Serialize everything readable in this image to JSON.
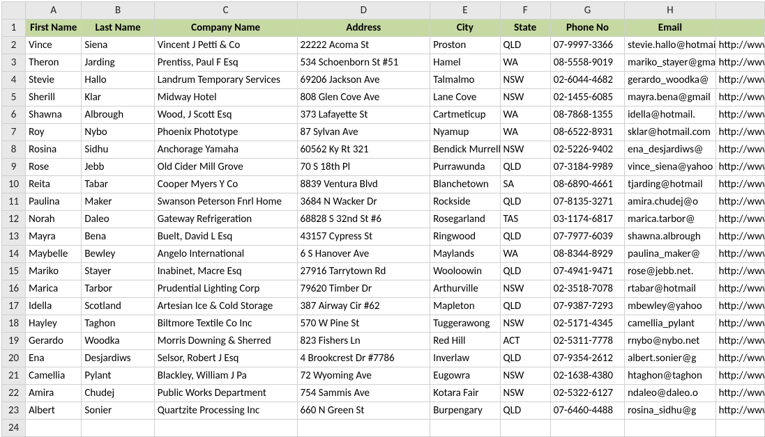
{
  "columns": [
    "A",
    "B",
    "C",
    "D",
    "E",
    "F",
    "G",
    "H",
    ""
  ],
  "headers": [
    "First Name",
    "Last Name",
    "Company Name",
    "Address",
    "City",
    "State",
    "Phone No",
    "Email",
    ""
  ],
  "rows": [
    {
      "n": 2,
      "c": [
        "Vince",
        "Siena",
        "Vincent J Petti & Co",
        "22222 Acoma St",
        "Proston",
        "QLD",
        "07-9997-3366",
        "stevie.hallo@hotmail.com",
        "http://www"
      ]
    },
    {
      "n": 3,
      "c": [
        "Theron",
        "Jarding",
        "Prentiss, Paul F Esq",
        "534 Schoenborn St #51",
        "Hamel",
        "WA",
        "08-5558-9019",
        "mariko_stayer@gmail.com",
        "http://www"
      ]
    },
    {
      "n": 4,
      "c": [
        "Stevie",
        "Hallo",
        "Landrum Temporary Services",
        "69206 Jackson Ave",
        "Talmalmo",
        "NSW",
        "02-6044-4682",
        "gerardo_woodka@",
        "http://www"
      ]
    },
    {
      "n": 5,
      "c": [
        "Sherill",
        "Klar",
        "Midway Hotel",
        "808 Glen Cove Ave",
        "Lane Cove",
        "NSW",
        "02-1455-6085",
        "mayra.bena@gmail",
        "http://www"
      ]
    },
    {
      "n": 6,
      "c": [
        "Shawna",
        "Albrough",
        "Wood, J Scott Esq",
        "373 Lafayette St",
        "Cartmeticup",
        "WA",
        "08-7868-1355",
        "idella@hotmail.",
        "http://www"
      ]
    },
    {
      "n": 7,
      "c": [
        "Roy",
        "Nybo",
        "Phoenix Phototype",
        "87 Sylvan Ave",
        "Nyamup",
        "WA",
        "08-6522-8931",
        "sklar@hotmail.com",
        "http://www"
      ]
    },
    {
      "n": 8,
      "c": [
        "Rosina",
        "Sidhu",
        "Anchorage Yamaha",
        "60562 Ky Rt 321",
        "Bendick Murrell",
        "NSW",
        "02-5226-9402",
        "ena_desjardiws@",
        "http://www"
      ]
    },
    {
      "n": 9,
      "c": [
        "Rose",
        "Jebb",
        "Old Cider Mill Grove",
        "70 S 18th Pl",
        "Purrawunda",
        "QLD",
        "07-3184-9989",
        "vince_siena@yahoo",
        "http://www"
      ]
    },
    {
      "n": 10,
      "c": [
        "Reita",
        "Tabar",
        "Cooper Myers Y Co",
        "8839 Ventura Blvd",
        "Blanchetown",
        "SA",
        "08-6890-4661",
        "tjarding@hotmail",
        "http://www"
      ]
    },
    {
      "n": 11,
      "c": [
        "Paulina",
        "Maker",
        "Swanson Peterson Fnrl Home",
        "3684 N Wacker Dr",
        "Rockside",
        "QLD",
        "07-8135-3271",
        "amira.chudej@o",
        "http://www"
      ]
    },
    {
      "n": 12,
      "c": [
        "Norah",
        "Daleo",
        "Gateway Refrigeration",
        "68828 S 32nd St #6",
        "Rosegarland",
        "TAS",
        "03-1174-6817",
        "marica.tarbor@",
        "http://www"
      ]
    },
    {
      "n": 13,
      "c": [
        "Mayra",
        "Bena",
        "Buelt, David L Esq",
        "43157 Cypress St",
        "Ringwood",
        "QLD",
        "07-7977-6039",
        "shawna.albrough",
        "http://www"
      ]
    },
    {
      "n": 14,
      "c": [
        "Maybelle",
        "Bewley",
        "Angelo International",
        "6 S Hanover Ave",
        "Maylands",
        "WA",
        "08-8344-8929",
        "paulina_maker@",
        "http://www"
      ]
    },
    {
      "n": 15,
      "c": [
        "Mariko",
        "Stayer",
        "Inabinet, Macre Esq",
        "27916 Tarrytown Rd",
        "Wooloowin",
        "QLD",
        "07-4941-9471",
        "rose@jebb.net.",
        "http://www"
      ]
    },
    {
      "n": 16,
      "c": [
        "Marica",
        "Tarbor",
        "Prudential Lighting Corp",
        "79620 Timber Dr",
        "Arthurville",
        "NSW",
        "02-3518-7078",
        "rtabar@hotmail",
        "http://www"
      ]
    },
    {
      "n": 17,
      "c": [
        "Idella",
        "Scotland",
        "Artesian Ice & Cold Storage",
        "387 Airway Cir #62",
        "Mapleton",
        "QLD",
        "07-9387-7293",
        "mbewley@yahoo",
        "http://www"
      ]
    },
    {
      "n": 18,
      "c": [
        "Hayley",
        "Taghon",
        "Biltmore Textile Co Inc",
        "570 W Pine St",
        "Tuggerawong",
        "NSW",
        "02-5171-4345",
        "camellia_pylant",
        "http://www"
      ]
    },
    {
      "n": 19,
      "c": [
        "Gerardo",
        "Woodka",
        "Morris Downing & Sherred",
        "823 Fishers Ln",
        "Red Hill",
        "ACT",
        "02-5311-7778",
        "rnybo@nybo.net",
        "http://www"
      ]
    },
    {
      "n": 20,
      "c": [
        "Ena",
        "Desjardiws",
        "Selsor, Robert J Esq",
        "4 Brookcrest Dr #7786",
        "Inverlaw",
        "QLD",
        "07-9354-2612",
        "albert.sonier@g",
        "http://www"
      ]
    },
    {
      "n": 21,
      "c": [
        "Camellia",
        "Pylant",
        "Blackley, William J Pa",
        "72 Wyoming Ave",
        "Eugowra",
        "NSW",
        "02-1638-4380",
        "htaghon@taghon",
        "http://www"
      ]
    },
    {
      "n": 22,
      "c": [
        "Amira",
        "Chudej",
        "Public Works Department",
        "754 Sammis Ave",
        "Kotara Fair",
        "NSW",
        "02-5322-6127",
        "ndaleo@daleo.o",
        "http://www"
      ]
    },
    {
      "n": 23,
      "c": [
        "Albert",
        "Sonier",
        "Quartzite Processing Inc",
        "660 N Green St",
        "Burpengary",
        "QLD",
        "07-6460-4488",
        "rosina_sidhu@g",
        "http://www"
      ]
    },
    {
      "n": 24,
      "c": [
        "",
        "",
        "",
        "",
        "",
        "",
        "",
        "",
        ""
      ]
    }
  ]
}
